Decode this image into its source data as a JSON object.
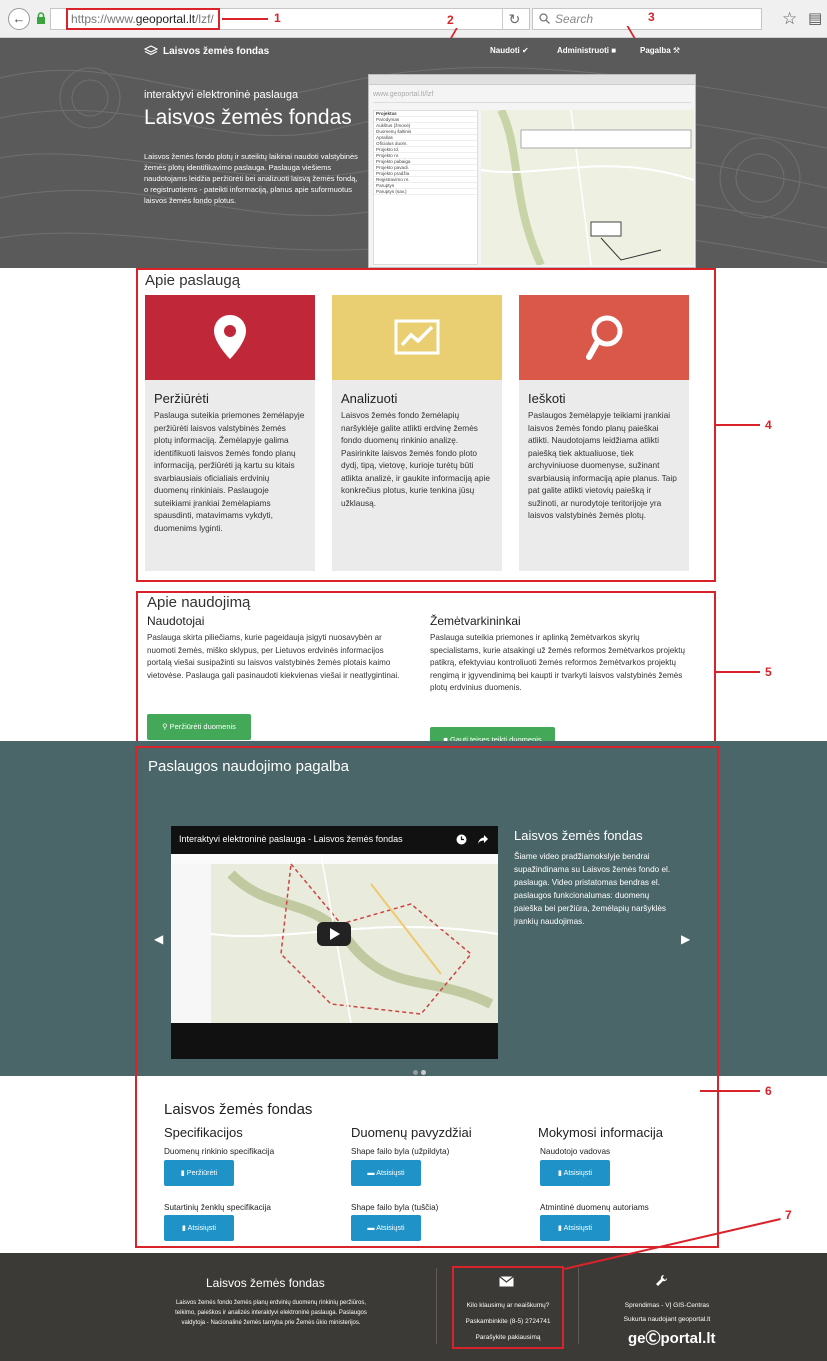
{
  "browser": {
    "url_prefix": "https://www.",
    "url_domain": "geoportal.lt",
    "url_path": "/lzf/",
    "search_placeholder": "Search"
  },
  "annotations": {
    "n1": "1",
    "n2": "2",
    "n3": "3",
    "n4": "4",
    "n5": "5",
    "n6": "6",
    "n7": "7"
  },
  "header": {
    "logo_text": "Laisvos žemės fondas",
    "nav_use": "Naudoti",
    "nav_admin": "Administruoti",
    "nav_help": "Pagalba"
  },
  "hero": {
    "subtitle": "interaktyvi elektroninė paslauga",
    "title": "Laisvos žemės fondas",
    "description": "Laisvos žemės fondo plotų ir suteiktų laikinai naudoti valstybinės žemės plotų identifikavimo paslauga. Paslauga viešiems naudotojams leidžia peržiūrėti bei analizuoti laisvą žemės fondą, o registruotiems - pateikti informaciją, planus apie suformuotus laisvos žemės fondo plotus.",
    "screen_url": "www.geoportal.lt/lzf",
    "screen_panel_title": "Projektas",
    "screen_rows": [
      "Parodymas",
      "Aukštus (žmonė)",
      "Duomenų šaltinis",
      "Aprašas",
      "Oficialus duom.",
      "Projekto Id.",
      "Projekto nr.",
      "Projekto pabaiga",
      "Projekto pavadi.",
      "Projekto pradžia",
      "Registravimo nr.",
      "Paruptys",
      "Paruptys (sav.)"
    ]
  },
  "about": {
    "title": "Apie paslaugą",
    "cards": [
      {
        "title": "Peržiūrėti",
        "color": "#c0283a",
        "text": "Paslauga suteikia priemones žemėlapyje peržiūrėti laisvos valstybinės žemės plotų informaciją. Žemėlapyje galima identifikuoti laisvos žemės fondo planų informaciją, peržiūrėti ją kartu su kitais svarbiausiais oficialiais erdvinių duomenų rinkiniais. Paslaugoje suteikiami įrankiai žemėlapiams spausdinti, matavimams vykdyti, duomenims lyginti."
      },
      {
        "title": "Analizuoti",
        "color": "#e9cf72",
        "text": "Laisvos žemės fondo žemėlapių naršyklėje galite atlikti erdvinę žemės fondo duomenų rinkinio analizę. Pasirinkite laisvos žemės fondo ploto dydį, tipą, vietovę, kurioje turėtų būti atlikta analizė, ir gaukite informaciją apie konkrečius plotus, kurie tenkina jūsų užklausą."
      },
      {
        "title": "Ieškoti",
        "color": "#d9584a",
        "text": "Paslaugos žemėlapyje teikiami įrankiai laisvos žemės fondo planų paieškai atlikti. Naudotojams leidžiama atlikti paiešką tiek aktualiuose, tiek archyviniuose duomenyse, sužinant svarbiausią informaciją apie planus. Taip pat galite atlikti vietovių paiešką ir sužinoti, ar nurodytoje teritorijoje yra laisvos valstybinės žemės plotų."
      }
    ]
  },
  "usage": {
    "title": "Apie naudojimą",
    "users_title": "Naudotojai",
    "users_text": "Paslauga skirta piliečiams, kurie pageidauja įsigyti nuosavybėn ar nuomoti žemės, miško sklypus, per Lietuvos erdvinės informacijos portalą viešai susipažinti su laisvos valstybinės žemės plotais kaimo vietovėse. Paslauga gali pasinaudoti kiekvienas viešai ir neatlygintinai.",
    "users_button": "Peržiūrėti duomenis",
    "managers_title": "Žemėtvarkininkai",
    "managers_text": "Paslauga suteikia priemones ir aplinką žemėtvarkos skyrių specialistams, kurie atsakingi už žemės reformos žemėtvarkos projektų patikrą, efektyviau kontroliuoti žemės reformos žemėtvarkos projektų rengimą ir įgyvendinimą bei kaupti ir tvarkyti laisvos valstybinės žemės plotų erdvinius duomenis.",
    "managers_button": "Gauti teises teikti duomenis"
  },
  "help": {
    "title": "Paslaugos naudojimo pagalba",
    "video_title": "Interaktyvi elektroninė paslauga - Laisvos žemės fondas",
    "side_title": "Laisvos žemės fondas",
    "side_text": "Šiame video pradžiamokslyje bendrai supažindinama su Laisvos žemės fondo el. paslauga. Video pristatomas bendras el. paslaugos funkcionalumas: duomenų paieška bei peržiūra, žemėlapių naršyklės įrankių naudojimas."
  },
  "downloads": {
    "title": "Laisvos žemės fondas",
    "col1_title": "Specifikacijos",
    "col2_title": "Duomenų pavyzdžiai",
    "col3_title": "Mokymosi informacija",
    "items": [
      {
        "label": "Duomenų rinkinio specifikacija",
        "button": "Peržiūrėti"
      },
      {
        "label": "Sutartinių ženklų specifikacija",
        "button": "Atsisiųsti"
      },
      {
        "label": "Shape failo byla (užpildyta)",
        "button": "Atsisiųsti"
      },
      {
        "label": "Shape failo byla (tuščia)",
        "button": "Atsisiųsti"
      },
      {
        "label": "Naudotojo vadovas",
        "button": "Atsisiųsti"
      },
      {
        "label": "Atmintinė duomenų autoriams",
        "button": "Atsisiųsti"
      }
    ]
  },
  "footer": {
    "title": "Laisvos žemės fondas",
    "description": "Laisvos žemės fondo žemės planų erdvinių duomenų rinkinių peržiūros, teikimo, paieškos ir analizės interaktyvi elektroninė paslauga. Paslaugos valdytoja - Nacionalinė žemės tarnyba prie Žemės ūkio ministerijos.",
    "question": "Kilo klausimų ar neaiškumų?",
    "phone": "Paskambinkite (8-5) 2724741",
    "write": "Parašykite pakiausimą",
    "solution": "Sprendimas - VĮ GIS-Centras",
    "built_on": "Sukurta naudojant geoportal.lt",
    "logo": "geⒸportal.lt"
  }
}
